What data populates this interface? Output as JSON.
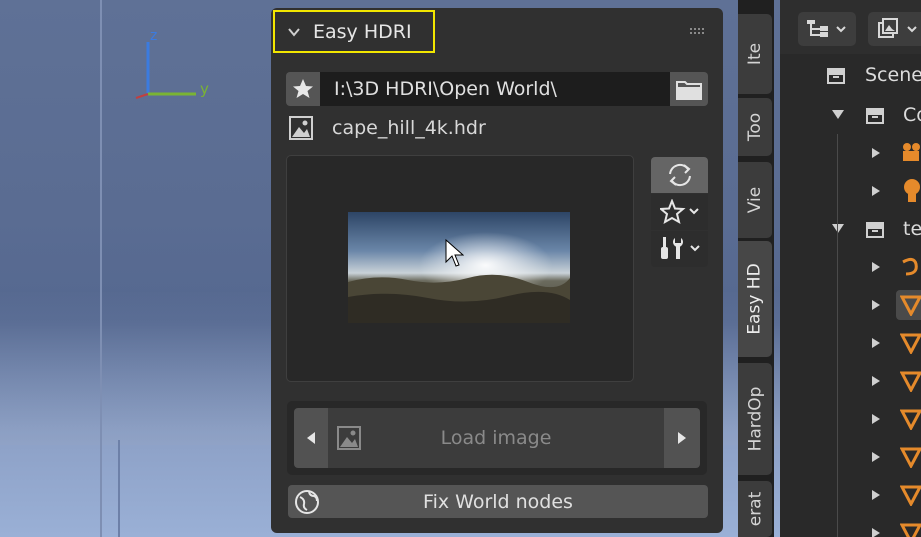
{
  "panel": {
    "header_title": "Easy HDRI",
    "path_value": "I:\\3D HDRI\\Open World\\",
    "file_name": "cape_hill_4k.hdr",
    "load_image_label": "Load image",
    "fix_world_label": "Fix World nodes"
  },
  "gizmo": {
    "z_label": "z",
    "y_label": "y"
  },
  "sidebar_tabs": [
    "Ite",
    "Too",
    "Vie",
    "Easy HD",
    "HardOp",
    "erat"
  ],
  "outliner": {
    "rows": [
      {
        "label": "Scene"
      },
      {
        "label": "Co"
      },
      {
        "label": ""
      },
      {
        "label": ""
      },
      {
        "label": "te"
      }
    ]
  },
  "colors": {
    "highlight_border": "#f2e600",
    "panel_bg": "#303030",
    "axis_y": "#7ab433",
    "axis_z": "#3b7be0",
    "mesh_orange": "#e58a2b"
  }
}
